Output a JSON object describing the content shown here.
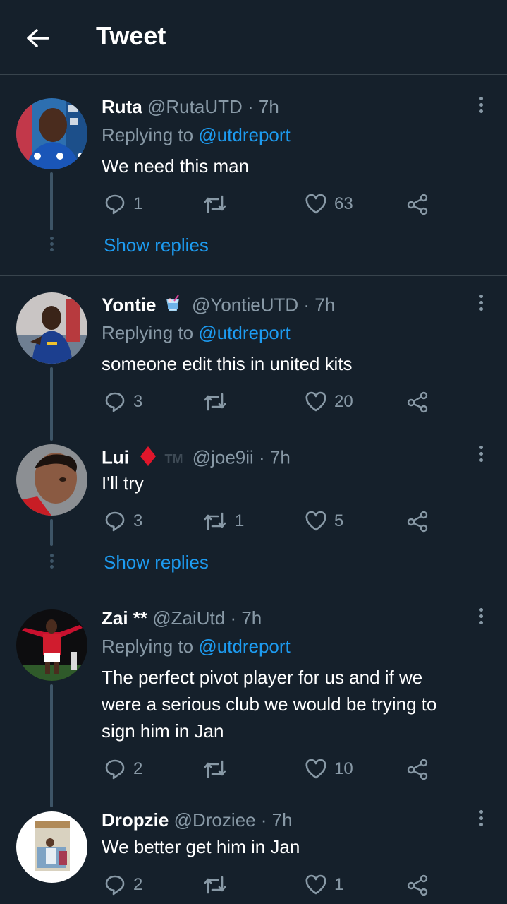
{
  "header": {
    "title": "Tweet"
  },
  "tweets": [
    {
      "name": "Ruta",
      "handle": "@RutaUTD · 7h",
      "replying_prefix": "Replying to ",
      "replying_to": "@utdreport",
      "text": "We need this man",
      "replies": "1",
      "retweets": "",
      "likes": "63",
      "show_replies": "Show replies"
    },
    {
      "name": "Yontie",
      "handle": "@YontieUTD · 7h",
      "replying_prefix": "Replying to ",
      "replying_to": "@utdreport",
      "text": "someone edit this in united kits",
      "replies": "3",
      "retweets": "",
      "likes": "20"
    },
    {
      "name": "Lui",
      "tm": "TM",
      "handle": "@joe9ii · 7h",
      "text": "I'll try",
      "replies": "3",
      "retweets": "1",
      "likes": "5",
      "show_replies": "Show replies"
    },
    {
      "name": "Zai **",
      "handle": "@ZaiUtd · 7h",
      "replying_prefix": "Replying to ",
      "replying_to": "@utdreport",
      "text_lines": [
        "The perfect pivot player for us and if we",
        "were a serious club we would be trying to",
        "sign him in Jan"
      ],
      "replies": "2",
      "retweets": "",
      "likes": "10"
    },
    {
      "name": "Dropzie",
      "handle": "@Droziee · 7h",
      "text": "We better get him in Jan",
      "replies": "2",
      "retweets": "",
      "likes": "1"
    }
  ],
  "colors": {
    "background": "#15202b",
    "accent": "#1d9bf0",
    "muted": "#8899a6",
    "divider": "#38444d",
    "lui_diamond": "#e0162b"
  },
  "icons": [
    "back-arrow-icon",
    "more-icon",
    "reply-icon",
    "retweet-icon",
    "like-icon",
    "share-icon",
    "cocktail-emoji-icon",
    "diamond-icon"
  ]
}
